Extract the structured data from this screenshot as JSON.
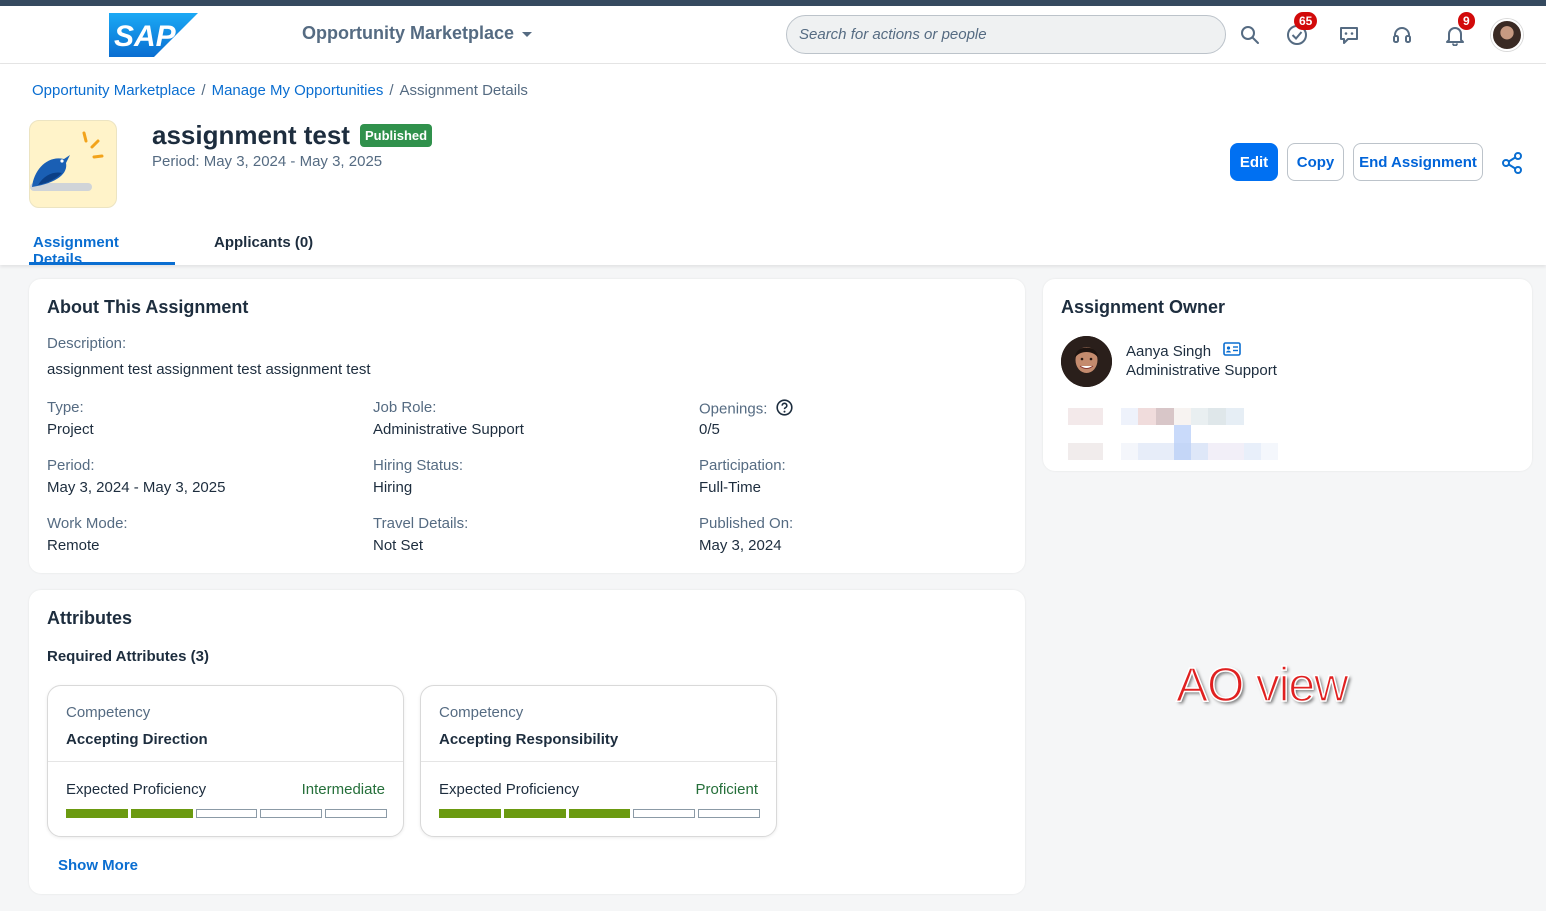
{
  "shell": {
    "app_title": "Opportunity Marketplace",
    "search_placeholder": "Search for actions or people",
    "tasks_badge": "65",
    "notifications_badge": "9",
    "icons": [
      "search-icon",
      "task-check-icon",
      "chat-bot-icon",
      "headset-icon",
      "bell-icon"
    ]
  },
  "breadcrumb": {
    "items": [
      "Opportunity Marketplace",
      "Manage My Opportunities"
    ],
    "current": "Assignment Details",
    "separator": "/"
  },
  "header": {
    "title": "assignment test",
    "status": "Published",
    "period": "Period: May 3, 2024 - May 3, 2025",
    "actions": {
      "edit": "Edit",
      "copy": "Copy",
      "end": "End Assignment"
    }
  },
  "tabs": [
    "Assignment Details",
    "Applicants (0)"
  ],
  "about": {
    "title": "About This Assignment",
    "description_label": "Description:",
    "description": "assignment test assignment test assignment test",
    "fields": [
      {
        "label": "Type:",
        "value": "Project"
      },
      {
        "label": "Job Role:",
        "value": "Administrative Support"
      },
      {
        "label": "Openings:",
        "value": "0/5"
      },
      {
        "label": "Period:",
        "value": "May 3, 2024 - May 3, 2025"
      },
      {
        "label": "Hiring Status:",
        "value": "Hiring"
      },
      {
        "label": "Participation:",
        "value": "Full-Time"
      },
      {
        "label": "Work Mode:",
        "value": "Remote"
      },
      {
        "label": "Travel Details:",
        "value": "Not Set"
      },
      {
        "label": "Published On:",
        "value": "May 3, 2024"
      }
    ]
  },
  "attributes": {
    "title": "Attributes",
    "required_label": "Required Attributes (3)",
    "items": [
      {
        "category": "Competency",
        "name": "Accepting Direction",
        "expected_label": "Expected Proficiency",
        "level": "Intermediate",
        "level_filled": 2,
        "level_total": 5
      },
      {
        "category": "Competency",
        "name": "Accepting Responsibility",
        "expected_label": "Expected Proficiency",
        "level": "Proficient",
        "level_filled": 3,
        "level_total": 5
      }
    ],
    "show_more": "Show More"
  },
  "owner": {
    "title": "Assignment Owner",
    "name": "Aanya Singh",
    "role": "Administrative Support"
  },
  "annotation": "AO view",
  "colors": {
    "primary": "#0070f2",
    "link": "#0a6ed1",
    "published": "#30914c",
    "proficiency_fill": "#6b9a10",
    "badge": "#d20a0a"
  }
}
